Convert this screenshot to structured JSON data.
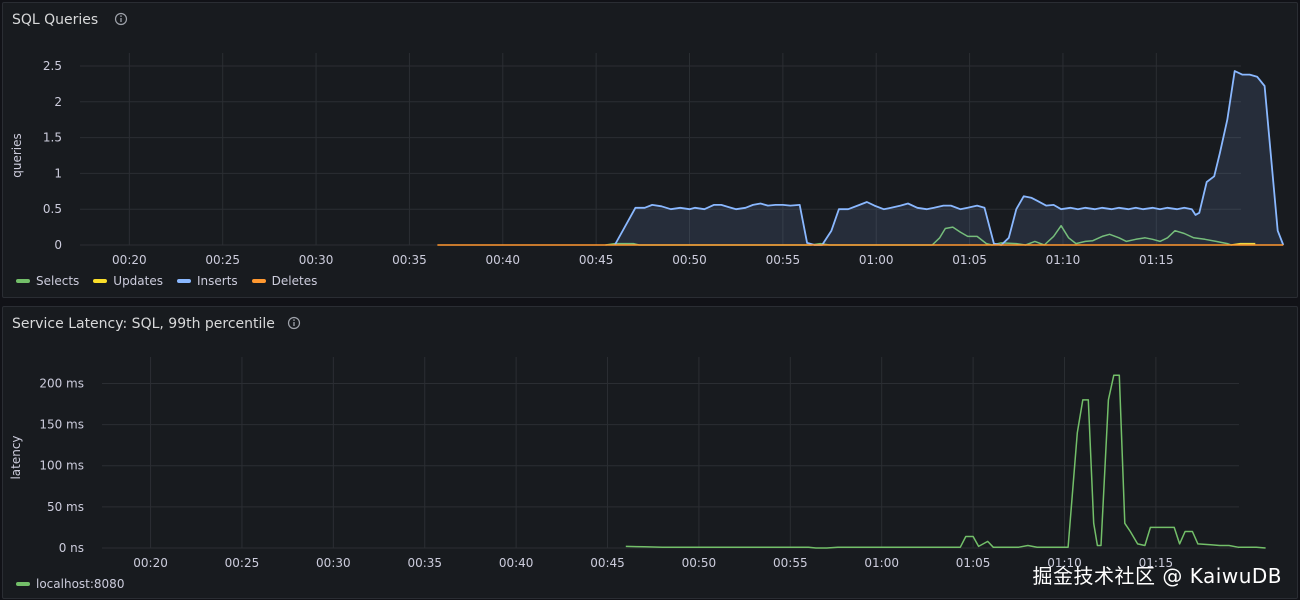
{
  "chart_data": [
    {
      "type": "area",
      "title": "SQL Queries",
      "ylabel": "queries",
      "xlabel": "",
      "x_ticks": [
        "00:20",
        "00:25",
        "00:30",
        "00:35",
        "00:40",
        "00:45",
        "00:50",
        "00:55",
        "01:00",
        "01:05",
        "01:10",
        "01:15"
      ],
      "y_ticks": [
        "0",
        "0.5",
        "1",
        "1.5",
        "2",
        "2.5"
      ],
      "xlim": [
        18,
        79
      ],
      "ylim": [
        0,
        2.5
      ],
      "grid": true,
      "legend_position": "bottom-left",
      "series": [
        {
          "name": "Selects",
          "color": "#73bf69",
          "fill": false,
          "points": [
            [
              45.5,
              0
            ],
            [
              46,
              0.02
            ],
            [
              47,
              0.02
            ],
            [
              47.3,
              0
            ],
            [
              56.5,
              0
            ],
            [
              57,
              0.02
            ],
            [
              57.5,
              0
            ],
            [
              63,
              0
            ],
            [
              63.4,
              0.1
            ],
            [
              63.7,
              0.23
            ],
            [
              64.1,
              0.25
            ],
            [
              64.5,
              0.18
            ],
            [
              64.9,
              0.12
            ],
            [
              65.4,
              0.12
            ],
            [
              65.9,
              0.02
            ],
            [
              66.2,
              0
            ],
            [
              66.7,
              0.03
            ],
            [
              67.5,
              0.02
            ],
            [
              68,
              0
            ],
            [
              68.5,
              0.05
            ],
            [
              69,
              0
            ],
            [
              69.5,
              0.12
            ],
            [
              69.9,
              0.27
            ],
            [
              70.3,
              0.1
            ],
            [
              70.7,
              0.02
            ],
            [
              71.2,
              0.05
            ],
            [
              71.6,
              0.06
            ],
            [
              72.1,
              0.12
            ],
            [
              72.5,
              0.15
            ],
            [
              73,
              0.1
            ],
            [
              73.4,
              0.05
            ],
            [
              73.9,
              0.08
            ],
            [
              74.4,
              0.1
            ],
            [
              74.8,
              0.08
            ],
            [
              75.2,
              0.05
            ],
            [
              75.6,
              0.1
            ],
            [
              76,
              0.2
            ],
            [
              76.5,
              0.16
            ],
            [
              77,
              0.1
            ],
            [
              77.6,
              0.08
            ],
            [
              78.2,
              0.05
            ],
            [
              78.8,
              0.02
            ],
            [
              79,
              0
            ]
          ]
        },
        {
          "name": "Updates",
          "color": "#fade2a",
          "fill": false,
          "points": [
            [
              79,
              0
            ],
            [
              79.5,
              0.02
            ],
            [
              80.3,
              0.02
            ]
          ]
        },
        {
          "name": "Inserts",
          "color": "#8ab8ff",
          "fill": true,
          "points": [
            [
              46,
              0
            ],
            [
              47.1,
              0.52
            ],
            [
              47.6,
              0.52
            ],
            [
              48,
              0.56
            ],
            [
              48.5,
              0.54
            ],
            [
              49,
              0.5
            ],
            [
              49.5,
              0.52
            ],
            [
              50,
              0.5
            ],
            [
              50.3,
              0.52
            ],
            [
              50.8,
              0.5
            ],
            [
              51.3,
              0.56
            ],
            [
              51.7,
              0.56
            ],
            [
              52.1,
              0.53
            ],
            [
              52.5,
              0.5
            ],
            [
              53,
              0.52
            ],
            [
              53.4,
              0.56
            ],
            [
              53.8,
              0.58
            ],
            [
              54.2,
              0.55
            ],
            [
              54.6,
              0.56
            ],
            [
              55,
              0.56
            ],
            [
              55.4,
              0.55
            ],
            [
              55.9,
              0.56
            ],
            [
              56.3,
              0.03
            ],
            [
              56.7,
              0
            ],
            [
              57.1,
              0
            ],
            [
              57.6,
              0.2
            ],
            [
              58,
              0.5
            ],
            [
              58.5,
              0.5
            ],
            [
              59,
              0.55
            ],
            [
              59.5,
              0.6
            ],
            [
              59.9,
              0.55
            ],
            [
              60.4,
              0.5
            ],
            [
              60.8,
              0.52
            ],
            [
              61.3,
              0.55
            ],
            [
              61.7,
              0.58
            ],
            [
              62.2,
              0.52
            ],
            [
              62.7,
              0.5
            ],
            [
              63.1,
              0.52
            ],
            [
              63.6,
              0.55
            ],
            [
              64,
              0.55
            ],
            [
              64.5,
              0.5
            ],
            [
              64.9,
              0.52
            ],
            [
              65.4,
              0.55
            ],
            [
              65.8,
              0.52
            ],
            [
              66.3,
              0.02
            ],
            [
              66.7,
              0
            ],
            [
              67.1,
              0.1
            ],
            [
              67.5,
              0.5
            ],
            [
              67.9,
              0.68
            ],
            [
              68.3,
              0.66
            ],
            [
              68.6,
              0.62
            ],
            [
              69.1,
              0.55
            ],
            [
              69.5,
              0.56
            ],
            [
              69.9,
              0.5
            ],
            [
              70.4,
              0.52
            ],
            [
              70.8,
              0.5
            ],
            [
              71.2,
              0.52
            ],
            [
              71.7,
              0.5
            ],
            [
              72.1,
              0.52
            ],
            [
              72.6,
              0.5
            ],
            [
              73,
              0.52
            ],
            [
              73.5,
              0.5
            ],
            [
              73.9,
              0.52
            ],
            [
              74.3,
              0.5
            ],
            [
              74.8,
              0.52
            ],
            [
              75.2,
              0.5
            ],
            [
              75.6,
              0.52
            ],
            [
              76.1,
              0.5
            ],
            [
              76.5,
              0.52
            ],
            [
              76.9,
              0.5
            ],
            [
              77.1,
              0.42
            ],
            [
              77.3,
              0.45
            ],
            [
              77.7,
              0.88
            ],
            [
              78.1,
              0.96
            ],
            [
              78.4,
              1.28
            ],
            [
              78.8,
              1.75
            ],
            [
              79.2,
              2.43
            ],
            [
              79.6,
              2.38
            ],
            [
              80,
              2.38
            ],
            [
              80.4,
              2.35
            ],
            [
              80.8,
              2.22
            ],
            [
              81.5,
              0.2
            ],
            [
              81.8,
              0
            ]
          ]
        },
        {
          "name": "Deletes",
          "color": "#ff9830",
          "fill": false,
          "points": [
            [
              36.5,
              0
            ],
            [
              81.8,
              0
            ]
          ]
        }
      ]
    },
    {
      "type": "line",
      "title": "Service Latency: SQL, 99th percentile",
      "ylabel": "latency",
      "xlabel": "",
      "x_ticks": [
        "00:20",
        "00:25",
        "00:30",
        "00:35",
        "00:40",
        "00:45",
        "00:50",
        "00:55",
        "01:00",
        "01:05",
        "01:10",
        "01:15"
      ],
      "y_ticks": [
        "0 ns",
        "50 ms",
        "100 ms",
        "150 ms",
        "200 ms"
      ],
      "xlim": [
        18,
        79
      ],
      "ylim": [
        0,
        220
      ],
      "grid": true,
      "legend_position": "bottom-left",
      "series": [
        {
          "name": "localhost:8080",
          "color": "#73bf69",
          "fill": false,
          "points": [
            [
              46,
              2
            ],
            [
              47,
              1.5
            ],
            [
              48,
              1
            ],
            [
              56,
              1
            ],
            [
              56.4,
              0
            ],
            [
              57,
              0
            ],
            [
              57.6,
              1
            ],
            [
              59,
              1
            ],
            [
              61,
              1
            ],
            [
              63,
              1
            ],
            [
              64.3,
              1
            ],
            [
              64.6,
              14
            ],
            [
              65,
              14
            ],
            [
              65.3,
              2
            ],
            [
              65.8,
              8
            ],
            [
              66.1,
              1
            ],
            [
              67.5,
              1
            ],
            [
              68,
              3
            ],
            [
              68.5,
              1
            ],
            [
              70.2,
              1
            ],
            [
              70.7,
              140
            ],
            [
              71,
              180
            ],
            [
              71.3,
              180
            ],
            [
              71.6,
              30
            ],
            [
              71.8,
              3
            ],
            [
              72,
              3
            ],
            [
              72.4,
              180
            ],
            [
              72.7,
              210
            ],
            [
              73,
              210
            ],
            [
              73.3,
              30
            ],
            [
              73.6,
              20
            ],
            [
              74,
              5
            ],
            [
              74.4,
              3
            ],
            [
              74.7,
              25
            ],
            [
              75,
              25
            ],
            [
              75.8,
              25
            ],
            [
              76,
              25
            ],
            [
              76.3,
              5
            ],
            [
              76.6,
              20
            ],
            [
              77,
              20
            ],
            [
              77.3,
              5
            ],
            [
              78,
              4
            ],
            [
              78.5,
              3
            ],
            [
              79,
              3
            ],
            [
              79.5,
              1
            ],
            [
              80.5,
              1
            ],
            [
              81,
              0
            ]
          ]
        }
      ]
    }
  ],
  "watermark": "掘金技术社区 @ KaiwuDB"
}
